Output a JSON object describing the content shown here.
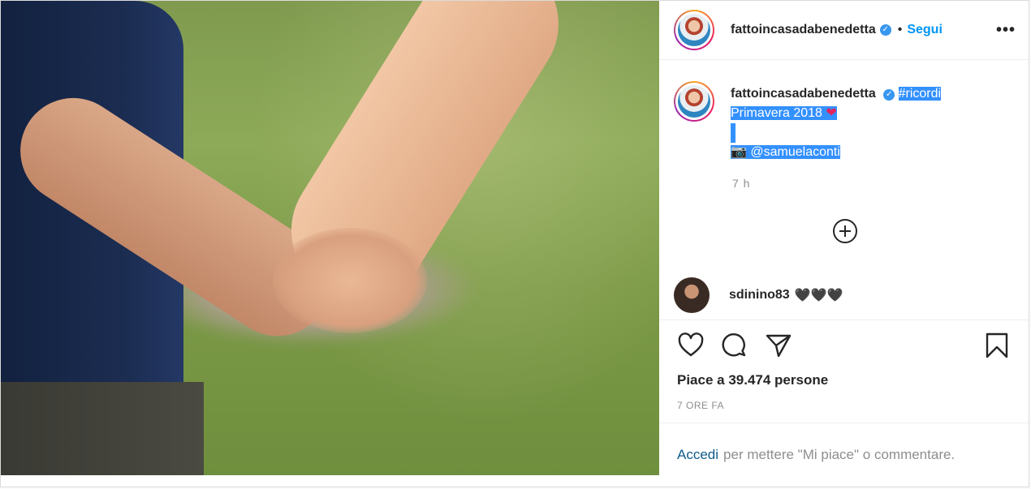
{
  "header": {
    "username": "fattoincasadabenedetta",
    "dot": "•",
    "follow_label": "Segui",
    "more_label": "•••"
  },
  "caption": {
    "username": "fattoincasadabenedetta",
    "hashtag": "#ricordi",
    "line2": "Primavera 2018",
    "heart": "❤",
    "camera": "📷",
    "mention": "@samuelaconti",
    "time": "7 h"
  },
  "comment": {
    "username": "sdinino83",
    "text": "🖤🖤🖤"
  },
  "footer": {
    "likes": "Piace a 39.474 persone",
    "ago": "7 ORE FA",
    "login_link": "Accedi",
    "login_text": "per mettere \"Mi piace\" o commentare."
  },
  "colors": {
    "accent": "#0095f6",
    "selection": "#3390ff",
    "verified": "#3897f0"
  }
}
